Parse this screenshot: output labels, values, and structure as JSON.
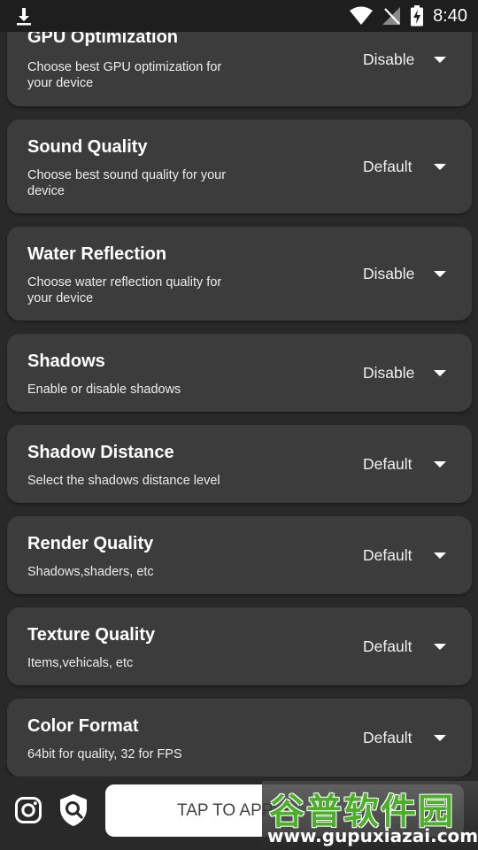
{
  "status_bar": {
    "time": "8:40"
  },
  "settings": [
    {
      "title": "GPU Optimization",
      "description": "Choose best GPU optimization for your device",
      "value": "Disable"
    },
    {
      "title": "Sound Quality",
      "description": "Choose best sound quality for your device",
      "value": "Default"
    },
    {
      "title": "Water Reflection",
      "description": "Choose water reflection quality for your device",
      "value": "Disable"
    },
    {
      "title": "Shadows",
      "description": "Enable or disable shadows",
      "value": "Disable"
    },
    {
      "title": "Shadow Distance",
      "description": "Select the shadows distance level",
      "value": "Default"
    },
    {
      "title": "Render Quality",
      "description": "Shadows,shaders, etc",
      "value": "Default"
    },
    {
      "title": "Texture Quality",
      "description": "Items,vehicals, etc",
      "value": "Default"
    },
    {
      "title": "Color Format",
      "description": "64bit for quality, 32 for FPS",
      "value": "Default"
    }
  ],
  "bottom_bar": {
    "apply_label": "TAP TO APPLY",
    "icons": [
      "instagram-icon",
      "shield-search-icon"
    ]
  },
  "watermark": {
    "name": "谷普软件园",
    "url": "www.gupuxiazai.com"
  }
}
